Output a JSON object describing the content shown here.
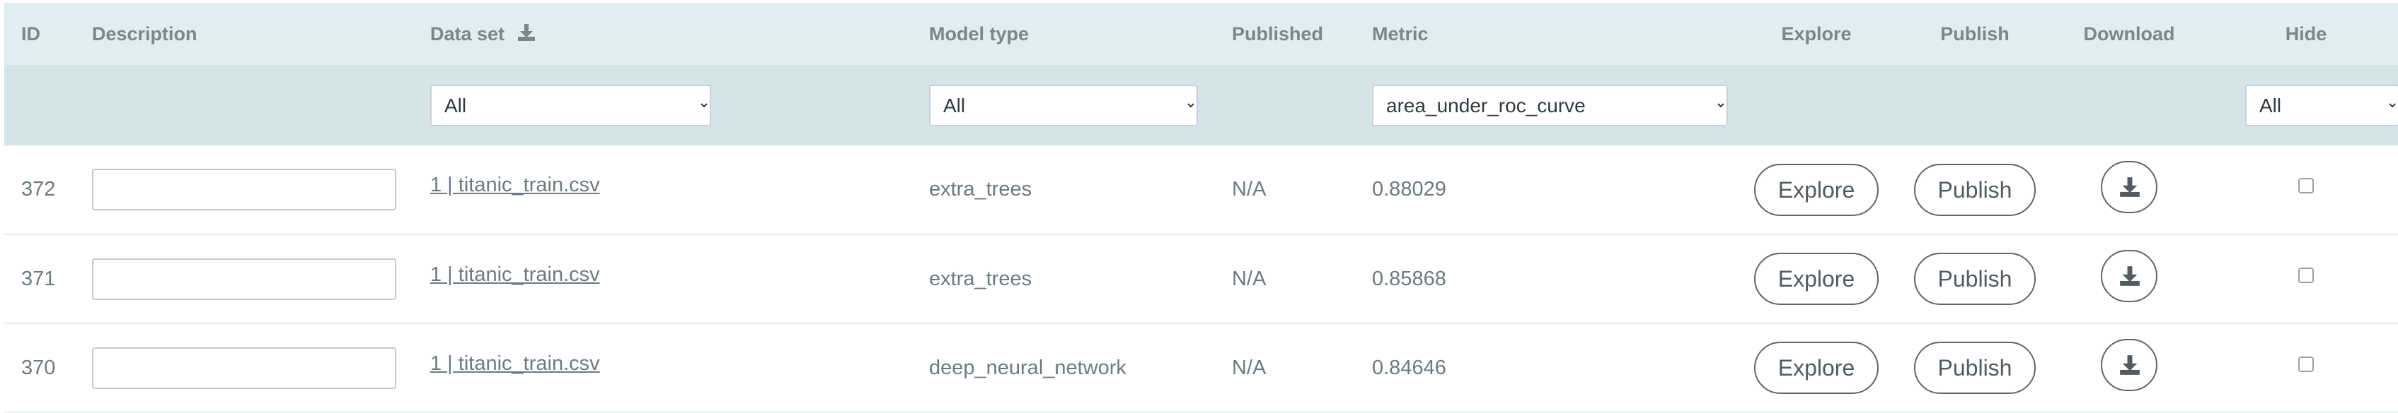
{
  "columns": {
    "id": "ID",
    "description": "Description",
    "data_set": "Data set",
    "model_type": "Model type",
    "published": "Published",
    "metric": "Metric",
    "explore": "Explore",
    "publish": "Publish",
    "download": "Download",
    "hide": "Hide"
  },
  "icons": {
    "data_set_header": "download-icon",
    "row_download": "download-icon"
  },
  "filters": {
    "data_set": "All",
    "model_type": "All",
    "metric": "area_under_roc_curve",
    "hide": "All"
  },
  "rows": [
    {
      "id": "372",
      "description": "",
      "data_set": "1 | titanic_train.csv",
      "model_type": "extra_trees",
      "published": "N/A",
      "metric_value": "0.88029",
      "explore_label": "Explore",
      "publish_label": "Publish",
      "hidden": false
    },
    {
      "id": "371",
      "description": "",
      "data_set": "1 | titanic_train.csv",
      "model_type": "extra_trees",
      "published": "N/A",
      "metric_value": "0.85868",
      "explore_label": "Explore",
      "publish_label": "Publish",
      "hidden": false
    },
    {
      "id": "370",
      "description": "",
      "data_set": "1 | titanic_train.csv",
      "model_type": "deep_neural_network",
      "published": "N/A",
      "metric_value": "0.84646",
      "explore_label": "Explore",
      "publish_label": "Publish",
      "hidden": false
    }
  ]
}
